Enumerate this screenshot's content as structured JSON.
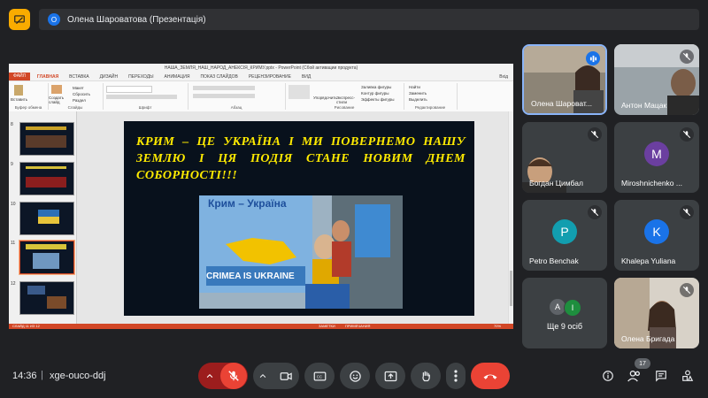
{
  "presenter": {
    "avatar_letter": "О",
    "title": "Олена Шароватова (Презентація)"
  },
  "ppt": {
    "window_title": "НАША_ЗЕМЛЯ_НАШ_НАРОД_АНЕКСІЯ_КРИМУ.pptx - PowerPoint (Сбой активации продукта)",
    "tabs": [
      "ФАЙЛ",
      "ГЛАВНАЯ",
      "ВСТАВКА",
      "ДИЗАЙН",
      "ПЕРЕХОДЫ",
      "АНИМАЦИЯ",
      "ПОКАЗ СЛАЙДОВ",
      "РЕЦЕНЗИРОВАНИЕ",
      "ВИД"
    ],
    "user": "Вхід",
    "groups": {
      "clipboard": "Буфер обмена",
      "slides": "Слайды",
      "font": "Шрифт",
      "paragraph": "Абзац",
      "drawing": "Рисование",
      "editing": "Редактирование"
    },
    "ribbon_items": {
      "paste": "Вставить",
      "new_slide": "Создать слайд",
      "layout": "Макет",
      "reset": "Сбросить",
      "section": "Раздел",
      "arrange": "Упорядочить",
      "quick_styles": "Экспресс-стили",
      "fill": "Заливка фигуры",
      "outline": "Контур фигуры",
      "effects": "Эффекты фигуры",
      "find": "Найти",
      "replace": "Заменить",
      "select": "Выделить"
    },
    "thumb_numbers": [
      "8",
      "9",
      "10",
      "11",
      "12"
    ],
    "selected_thumb": "11",
    "status_left": "СЛАЙД 11 ИЗ 12",
    "status_notes": "ЗАМЕТКИ",
    "status_comments": "ПРИМЕЧАНИЯ",
    "zoom": "70%"
  },
  "slide": {
    "text": "КРИМ – ЦЕ УКРАЇНА І МИ ПОВЕРНЕМО НАШУ ЗЕМЛЮ І ЦЯ ПОДІЯ СТАНЕ НОВИМ ДНЕМ СОБОРНОСТІ!!!",
    "banner_top": "Крим – Україна",
    "banner_bottom": "CRIMEA IS UKRAINE"
  },
  "participants": [
    {
      "name": "Олена Шароват...",
      "avatar": "",
      "speaking": true
    },
    {
      "name": "Антон Мацак",
      "avatar": "",
      "muted": true
    },
    {
      "name": "Богдан Цимбал",
      "avatar": "",
      "muted": true
    },
    {
      "name": "Miroshnichenko ...",
      "avatar": "M",
      "color": "#6b3fa0",
      "muted": true
    },
    {
      "name": "Petro Benchak",
      "avatar": "P",
      "color": "#129eaf",
      "muted": true
    },
    {
      "name": "Khalepa Yuliana",
      "avatar": "K",
      "color": "#1a73e8",
      "muted": true
    },
    {
      "name": "Олена Бригада",
      "avatar": "",
      "muted": true
    }
  ],
  "others": {
    "label": "Ще 9 осіб",
    "avatars": [
      "A",
      "I"
    ],
    "colors": [
      "#5f6368",
      "#1e8e3e"
    ]
  },
  "bottom": {
    "time": "14:36",
    "separator": "|",
    "meeting_code": "xge-ouco-ddj",
    "people_count": "17"
  },
  "colors": {
    "accent_yellow": "#f9ab00",
    "end_call": "#ea4335",
    "mic_off_bg": "#9c1d1d",
    "speaking": "#1a73e8"
  },
  "icons": [
    "present-icon",
    "chevron-up-icon",
    "mic-off-icon",
    "camera-icon",
    "captions-icon",
    "emoji-icon",
    "present-screen-icon",
    "raise-hand-icon",
    "more-vert-icon",
    "end-call-icon",
    "info-icon",
    "people-icon",
    "chat-icon",
    "activities-icon"
  ]
}
